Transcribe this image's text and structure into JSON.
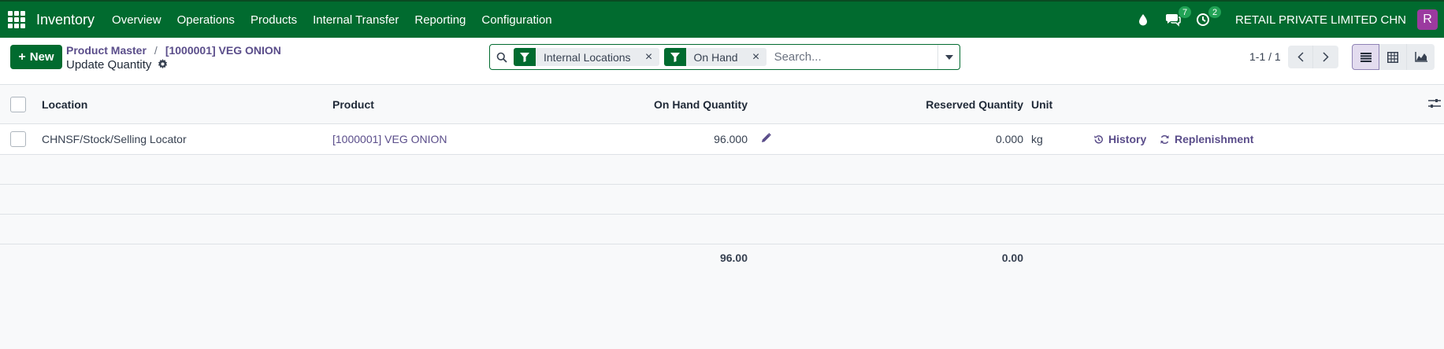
{
  "navbar": {
    "brand": "Inventory",
    "menu": [
      "Overview",
      "Operations",
      "Products",
      "Internal Transfer",
      "Reporting",
      "Configuration"
    ],
    "messages_count": "7",
    "activities_count": "2",
    "company": "RETAIL PRIVATE LIMITED CHN",
    "avatar_initial": "R",
    "icons": [
      "apps-grid-icon",
      "droplet-icon",
      "chat-icon",
      "clock-icon"
    ]
  },
  "control": {
    "new_label": "New",
    "breadcrumb": [
      "Product Master",
      "[1000001] VEG ONION"
    ],
    "title": "Update Quantity",
    "facets": [
      "Internal Locations",
      "On Hand"
    ],
    "search_placeholder": "Search...",
    "pager": "1-1 / 1"
  },
  "table": {
    "headers": {
      "location": "Location",
      "product": "Product",
      "on_hand": "On Hand Quantity",
      "reserved": "Reserved Quantity",
      "unit": "Unit"
    },
    "rows": [
      {
        "location": "CHNSF/Stock/Selling Locator",
        "product": "[1000001] VEG ONION",
        "on_hand": "96.000",
        "reserved": "0.000",
        "unit": "kg",
        "history_label": "History",
        "replenishment_label": "Replenishment"
      }
    ],
    "totals": {
      "on_hand": "96.00",
      "reserved": "0.00"
    }
  },
  "colors": {
    "primary": "#016b2f",
    "link": "#5a4d8a",
    "avatar": "#9b3a9f"
  }
}
